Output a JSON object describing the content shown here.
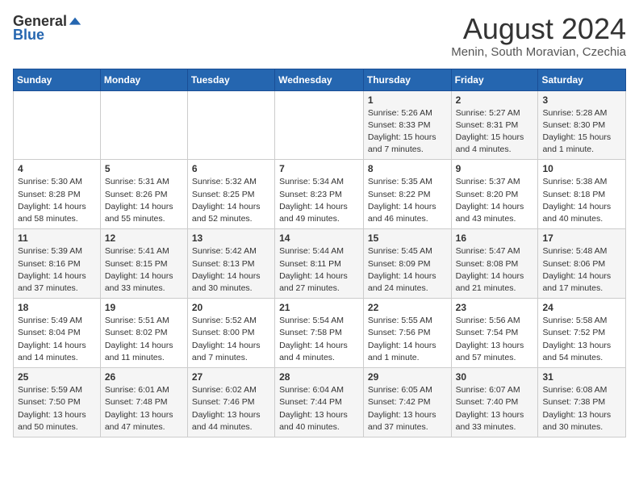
{
  "logo": {
    "general": "General",
    "blue": "Blue"
  },
  "title": "August 2024",
  "location": "Menin, South Moravian, Czechia",
  "days_of_week": [
    "Sunday",
    "Monday",
    "Tuesday",
    "Wednesday",
    "Thursday",
    "Friday",
    "Saturday"
  ],
  "weeks": [
    [
      {
        "day": "",
        "info": ""
      },
      {
        "day": "",
        "info": ""
      },
      {
        "day": "",
        "info": ""
      },
      {
        "day": "",
        "info": ""
      },
      {
        "day": "1",
        "info": "Sunrise: 5:26 AM\nSunset: 8:33 PM\nDaylight: 15 hours\nand 7 minutes."
      },
      {
        "day": "2",
        "info": "Sunrise: 5:27 AM\nSunset: 8:31 PM\nDaylight: 15 hours\nand 4 minutes."
      },
      {
        "day": "3",
        "info": "Sunrise: 5:28 AM\nSunset: 8:30 PM\nDaylight: 15 hours\nand 1 minute."
      }
    ],
    [
      {
        "day": "4",
        "info": "Sunrise: 5:30 AM\nSunset: 8:28 PM\nDaylight: 14 hours\nand 58 minutes."
      },
      {
        "day": "5",
        "info": "Sunrise: 5:31 AM\nSunset: 8:26 PM\nDaylight: 14 hours\nand 55 minutes."
      },
      {
        "day": "6",
        "info": "Sunrise: 5:32 AM\nSunset: 8:25 PM\nDaylight: 14 hours\nand 52 minutes."
      },
      {
        "day": "7",
        "info": "Sunrise: 5:34 AM\nSunset: 8:23 PM\nDaylight: 14 hours\nand 49 minutes."
      },
      {
        "day": "8",
        "info": "Sunrise: 5:35 AM\nSunset: 8:22 PM\nDaylight: 14 hours\nand 46 minutes."
      },
      {
        "day": "9",
        "info": "Sunrise: 5:37 AM\nSunset: 8:20 PM\nDaylight: 14 hours\nand 43 minutes."
      },
      {
        "day": "10",
        "info": "Sunrise: 5:38 AM\nSunset: 8:18 PM\nDaylight: 14 hours\nand 40 minutes."
      }
    ],
    [
      {
        "day": "11",
        "info": "Sunrise: 5:39 AM\nSunset: 8:16 PM\nDaylight: 14 hours\nand 37 minutes."
      },
      {
        "day": "12",
        "info": "Sunrise: 5:41 AM\nSunset: 8:15 PM\nDaylight: 14 hours\nand 33 minutes."
      },
      {
        "day": "13",
        "info": "Sunrise: 5:42 AM\nSunset: 8:13 PM\nDaylight: 14 hours\nand 30 minutes."
      },
      {
        "day": "14",
        "info": "Sunrise: 5:44 AM\nSunset: 8:11 PM\nDaylight: 14 hours\nand 27 minutes."
      },
      {
        "day": "15",
        "info": "Sunrise: 5:45 AM\nSunset: 8:09 PM\nDaylight: 14 hours\nand 24 minutes."
      },
      {
        "day": "16",
        "info": "Sunrise: 5:47 AM\nSunset: 8:08 PM\nDaylight: 14 hours\nand 21 minutes."
      },
      {
        "day": "17",
        "info": "Sunrise: 5:48 AM\nSunset: 8:06 PM\nDaylight: 14 hours\nand 17 minutes."
      }
    ],
    [
      {
        "day": "18",
        "info": "Sunrise: 5:49 AM\nSunset: 8:04 PM\nDaylight: 14 hours\nand 14 minutes."
      },
      {
        "day": "19",
        "info": "Sunrise: 5:51 AM\nSunset: 8:02 PM\nDaylight: 14 hours\nand 11 minutes."
      },
      {
        "day": "20",
        "info": "Sunrise: 5:52 AM\nSunset: 8:00 PM\nDaylight: 14 hours\nand 7 minutes."
      },
      {
        "day": "21",
        "info": "Sunrise: 5:54 AM\nSunset: 7:58 PM\nDaylight: 14 hours\nand 4 minutes."
      },
      {
        "day": "22",
        "info": "Sunrise: 5:55 AM\nSunset: 7:56 PM\nDaylight: 14 hours\nand 1 minute."
      },
      {
        "day": "23",
        "info": "Sunrise: 5:56 AM\nSunset: 7:54 PM\nDaylight: 13 hours\nand 57 minutes."
      },
      {
        "day": "24",
        "info": "Sunrise: 5:58 AM\nSunset: 7:52 PM\nDaylight: 13 hours\nand 54 minutes."
      }
    ],
    [
      {
        "day": "25",
        "info": "Sunrise: 5:59 AM\nSunset: 7:50 PM\nDaylight: 13 hours\nand 50 minutes."
      },
      {
        "day": "26",
        "info": "Sunrise: 6:01 AM\nSunset: 7:48 PM\nDaylight: 13 hours\nand 47 minutes."
      },
      {
        "day": "27",
        "info": "Sunrise: 6:02 AM\nSunset: 7:46 PM\nDaylight: 13 hours\nand 44 minutes."
      },
      {
        "day": "28",
        "info": "Sunrise: 6:04 AM\nSunset: 7:44 PM\nDaylight: 13 hours\nand 40 minutes."
      },
      {
        "day": "29",
        "info": "Sunrise: 6:05 AM\nSunset: 7:42 PM\nDaylight: 13 hours\nand 37 minutes."
      },
      {
        "day": "30",
        "info": "Sunrise: 6:07 AM\nSunset: 7:40 PM\nDaylight: 13 hours\nand 33 minutes."
      },
      {
        "day": "31",
        "info": "Sunrise: 6:08 AM\nSunset: 7:38 PM\nDaylight: 13 hours\nand 30 minutes."
      }
    ]
  ]
}
